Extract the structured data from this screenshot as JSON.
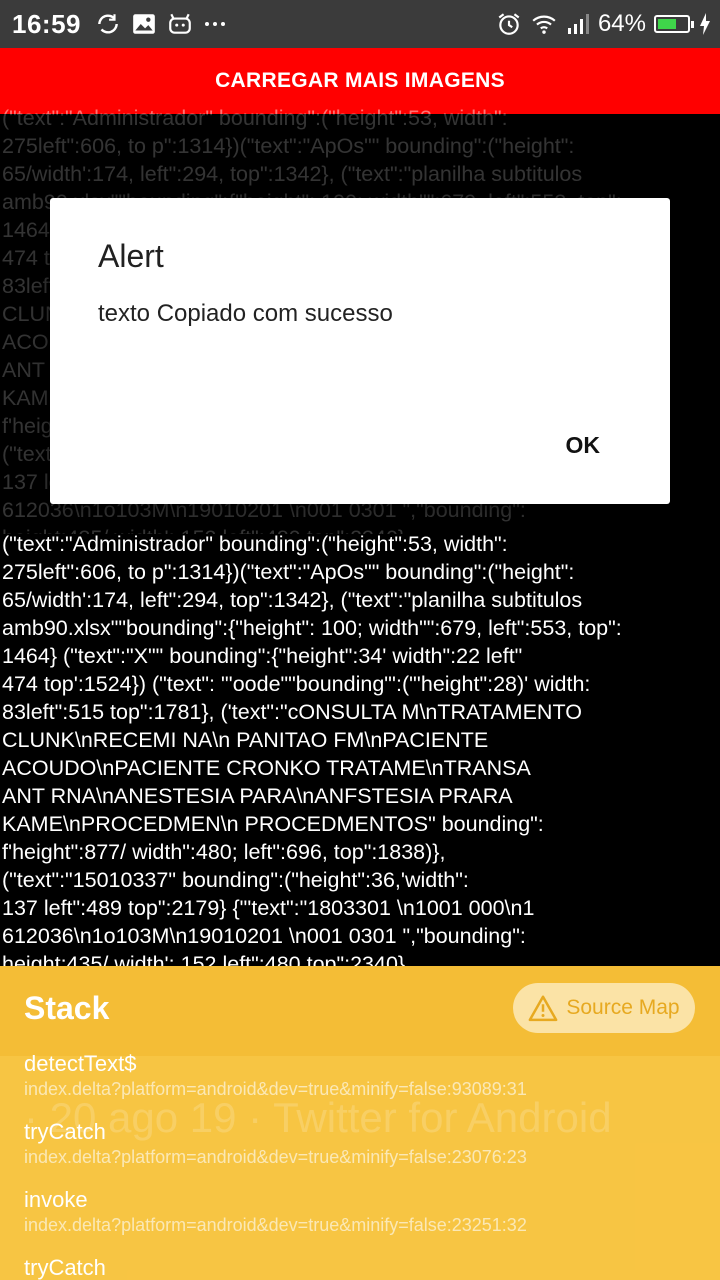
{
  "status_bar": {
    "time": "16:59",
    "battery_percent": "64%",
    "battery_level": 0.64,
    "left_icons": [
      "sync-icon",
      "image-icon",
      "android-icon",
      "more-icon"
    ],
    "right_icons": [
      "alarm-icon",
      "wifi-icon",
      "signal-icon",
      "battery-icon",
      "charging-icon"
    ]
  },
  "load_button": {
    "label": "CARREGAR MAIS IMAGENS",
    "color": "#ff0000"
  },
  "background_text_lines": [
    "(\"text\":\"Administrador\" bounding\":(\"height\":53, width\":",
    "275left\":606, to p\":1314})(\"text\":\"ApOs\"\" bounding\":(\"height\":",
    "65/width':174, left\":294, top\":1342}, (\"text\":\"planilha subtitulos",
    "amb90.xlsx\"\"bounding\":{\"height\": 100; width\"\":679, left\":553, top\":",
    "1464} (\"text\":\"X\"\" bounding\":{\"height\":34' width\":22 left\"",
    "474 top':1524}) (\"text\": \"'oode\"\"bounding\"':(\"'height\":28)' width:",
    "83left\":515 top\":1781}, ('text\":\"cONSULTA M\\nTRATAMENTO",
    "CLUNK\\nRECEMI NA\\n PANITAO FM\\nPACIENTE",
    "ACOUDO\\nPACIENTE CRONKO TRATAME\\nTRANSA",
    "ANT RNA\\nANESTESIA PARA\\nANFSTESIA PRARA",
    "KAME\\nPROCEDMEN\\n PROCEDMENTOS\" bounding\":",
    "f'height\":877/ width\":480; left\":696, top\":1838)},",
    "(\"text\":\"15010337\" bounding\":(\"height\":36,'width\":",
    "137 left\":489 top\":2179} {\"'text\":\"1803301 \\n1001 000\\n1",
    "612036\\n1o103M\\n19010201 \\n001 0301 \",\"bounding\":",
    "height:435/ width': 152 left\":480 top\":2340}"
  ],
  "alert": {
    "title": "Alert",
    "message": "texto Copiado com sucesso",
    "ok_label": "OK"
  },
  "stack": {
    "title": "Stack",
    "source_map_label": "Source Map",
    "ghost_caption": "· 20 ago 19 · Twitter for Android",
    "frames": [
      {
        "fn": "detectText$",
        "loc": "index.delta?platform=android&dev=true&minify=false:93089:31"
      },
      {
        "fn": "tryCatch",
        "loc": "index.delta?platform=android&dev=true&minify=false:23076:23"
      },
      {
        "fn": "invoke",
        "loc": "index.delta?platform=android&dev=true&minify=false:23251:32"
      },
      {
        "fn": "tryCatch",
        "loc": ""
      }
    ],
    "colors": {
      "panel": "#f7c033",
      "accent": "#e7a920"
    }
  }
}
